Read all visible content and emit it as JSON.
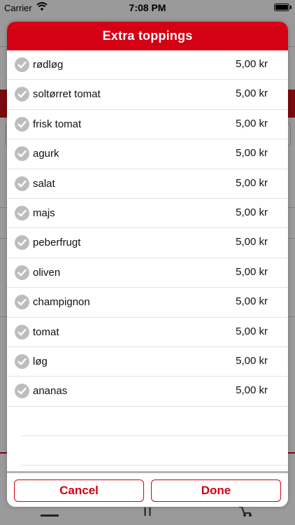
{
  "status_bar": {
    "carrier": "Carrier",
    "time": "7:08 PM",
    "battery_level": 1.0
  },
  "modal": {
    "title": "Extra toppings",
    "items": [
      {
        "name": "rødløg",
        "price": "5,00 kr",
        "checked": true
      },
      {
        "name": "soltørret tomat",
        "price": "5,00 kr",
        "checked": true
      },
      {
        "name": "frisk tomat",
        "price": "5,00 kr",
        "checked": true
      },
      {
        "name": "agurk",
        "price": "5,00 kr",
        "checked": true
      },
      {
        "name": "salat",
        "price": "5,00 kr",
        "checked": true
      },
      {
        "name": "majs",
        "price": "5,00 kr",
        "checked": true
      },
      {
        "name": "peberfrugt",
        "price": "5,00 kr",
        "checked": true
      },
      {
        "name": "oliven",
        "price": "5,00 kr",
        "checked": true
      },
      {
        "name": "champignon",
        "price": "5,00 kr",
        "checked": true
      },
      {
        "name": "tomat",
        "price": "5,00 kr",
        "checked": true
      },
      {
        "name": "løg",
        "price": "5,00 kr",
        "checked": true
      },
      {
        "name": "ananas",
        "price": "5,00 kr",
        "checked": true
      }
    ],
    "cancel_label": "Cancel",
    "done_label": "Done"
  },
  "colors": {
    "accent": "#d40013",
    "check_icon_bg": "#bdbdbd"
  },
  "icons": {
    "check": "checkmark-circle-icon",
    "wifi": "wifi-icon",
    "battery": "battery-icon",
    "tab_menu": "menu-lines-icon",
    "tab_pause": "pause-icon",
    "tab_cart": "cart-icon"
  }
}
